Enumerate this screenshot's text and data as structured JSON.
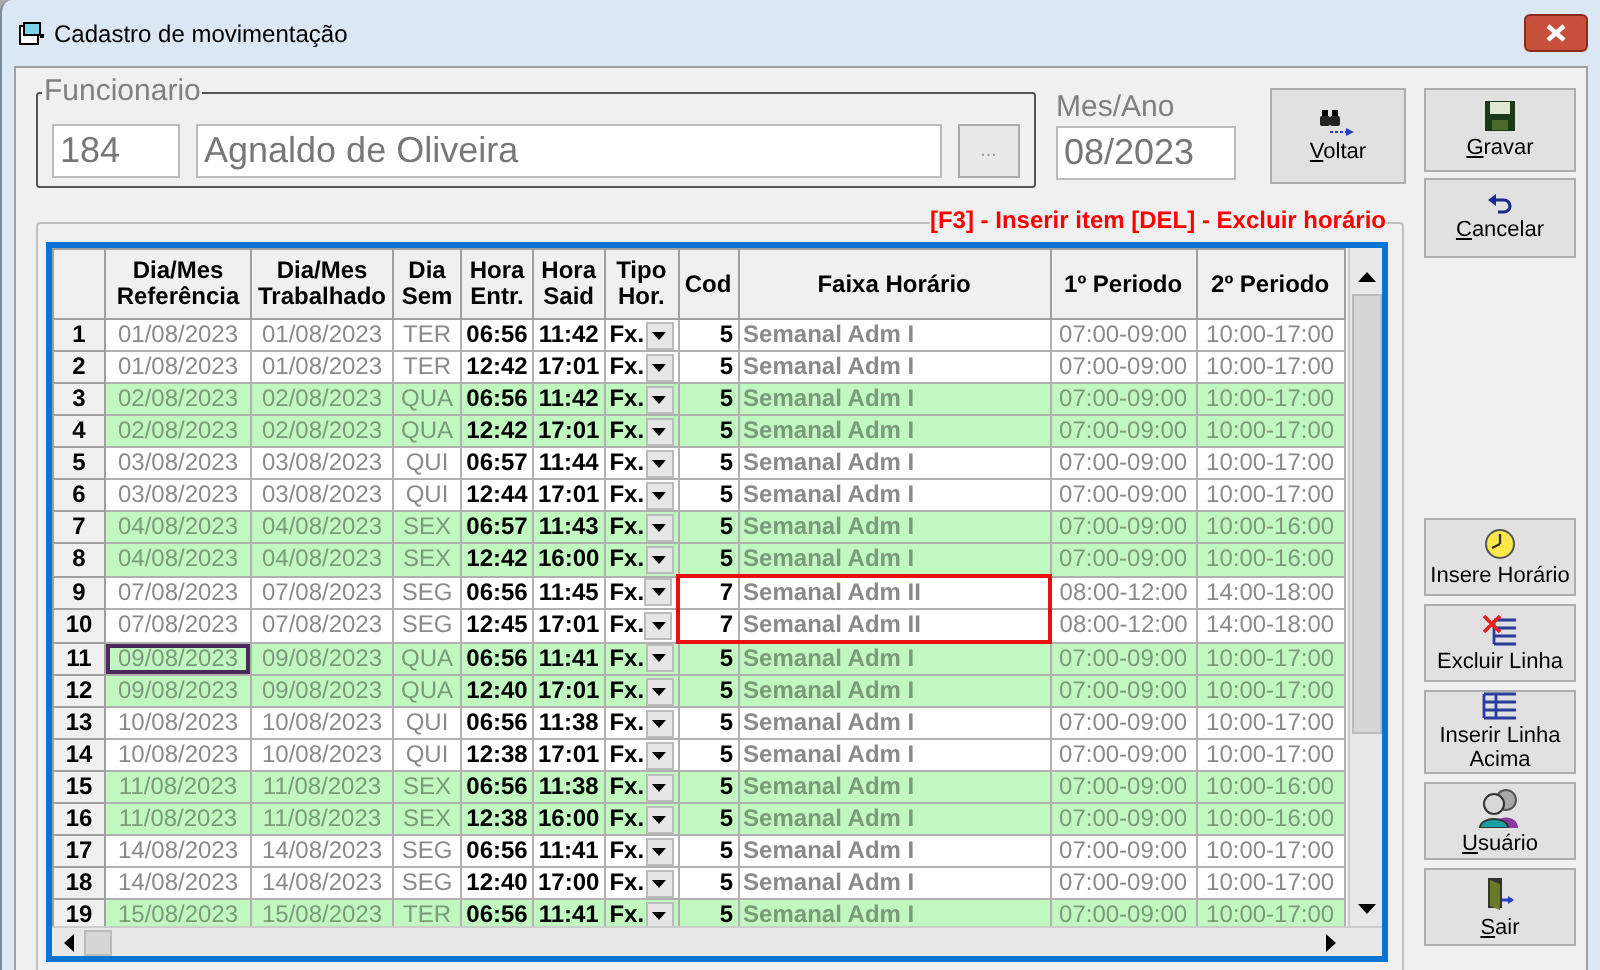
{
  "window": {
    "title": "Cadastro de movimentação"
  },
  "funcionario": {
    "label": "Funcionario",
    "code": "184",
    "name": "Agnaldo de Oliveira",
    "lookup_button": "..."
  },
  "mes_ano": {
    "label": "Mes/Ano",
    "value": "08/2023"
  },
  "top_buttons": [
    {
      "kind": "voltar",
      "label": "Voltar",
      "underline_first": true
    },
    {
      "kind": "gravar",
      "label": "Gravar",
      "underline_first": true
    },
    {
      "kind": "cancelar",
      "label": "Cancelar",
      "underline_first": true
    }
  ],
  "grid": {
    "hint": "[F3] - Inserir item [DEL] - Excluir horário",
    "columns": [
      "",
      "Dia/Mes Referência",
      "Dia/Mes Trabalhado",
      "Dia Sem",
      "Hora Entr.",
      "Hora Said",
      "Tipo Hor.",
      "Cod",
      "Faixa Horário",
      "1º Periodo",
      "2º Periodo"
    ],
    "rows": [
      {
        "n": "1",
        "ref": "01/08/2023",
        "trab": "01/08/2023",
        "dia": "TER",
        "entr": "06:56",
        "said": "11:42",
        "tipo": "Fx.",
        "cod": "5",
        "faixa": "Semanal Adm I",
        "p1": "07:00-09:00",
        "p2": "10:00-17:00",
        "shaded": false,
        "focused": false,
        "highlighted": false
      },
      {
        "n": "2",
        "ref": "01/08/2023",
        "trab": "01/08/2023",
        "dia": "TER",
        "entr": "12:42",
        "said": "17:01",
        "tipo": "Fx.",
        "cod": "5",
        "faixa": "Semanal Adm I",
        "p1": "07:00-09:00",
        "p2": "10:00-17:00",
        "shaded": false,
        "focused": false,
        "highlighted": false
      },
      {
        "n": "3",
        "ref": "02/08/2023",
        "trab": "02/08/2023",
        "dia": "QUA",
        "entr": "06:56",
        "said": "11:42",
        "tipo": "Fx.",
        "cod": "5",
        "faixa": "Semanal Adm I",
        "p1": "07:00-09:00",
        "p2": "10:00-17:00",
        "shaded": true,
        "focused": false,
        "highlighted": false
      },
      {
        "n": "4",
        "ref": "02/08/2023",
        "trab": "02/08/2023",
        "dia": "QUA",
        "entr": "12:42",
        "said": "17:01",
        "tipo": "Fx.",
        "cod": "5",
        "faixa": "Semanal Adm I",
        "p1": "07:00-09:00",
        "p2": "10:00-17:00",
        "shaded": true,
        "focused": false,
        "highlighted": false
      },
      {
        "n": "5",
        "ref": "03/08/2023",
        "trab": "03/08/2023",
        "dia": "QUI",
        "entr": "06:57",
        "said": "11:44",
        "tipo": "Fx.",
        "cod": "5",
        "faixa": "Semanal Adm I",
        "p1": "07:00-09:00",
        "p2": "10:00-17:00",
        "shaded": false,
        "focused": false,
        "highlighted": false
      },
      {
        "n": "6",
        "ref": "03/08/2023",
        "trab": "03/08/2023",
        "dia": "QUI",
        "entr": "12:44",
        "said": "17:01",
        "tipo": "Fx.",
        "cod": "5",
        "faixa": "Semanal Adm I",
        "p1": "07:00-09:00",
        "p2": "10:00-17:00",
        "shaded": false,
        "focused": false,
        "highlighted": false
      },
      {
        "n": "7",
        "ref": "04/08/2023",
        "trab": "04/08/2023",
        "dia": "SEX",
        "entr": "06:57",
        "said": "11:43",
        "tipo": "Fx.",
        "cod": "5",
        "faixa": "Semanal Adm I",
        "p1": "07:00-09:00",
        "p2": "10:00-16:00",
        "shaded": true,
        "focused": false,
        "highlighted": false
      },
      {
        "n": "8",
        "ref": "04/08/2023",
        "trab": "04/08/2023",
        "dia": "SEX",
        "entr": "12:42",
        "said": "16:00",
        "tipo": "Fx.",
        "cod": "5",
        "faixa": "Semanal Adm I",
        "p1": "07:00-09:00",
        "p2": "10:00-16:00",
        "shaded": true,
        "focused": false,
        "highlighted": false
      },
      {
        "n": "9",
        "ref": "07/08/2023",
        "trab": "07/08/2023",
        "dia": "SEG",
        "entr": "06:56",
        "said": "11:45",
        "tipo": "Fx.",
        "cod": "7",
        "faixa": "Semanal Adm II",
        "p1": "08:00-12:00",
        "p2": "14:00-18:00",
        "shaded": false,
        "focused": false,
        "highlighted": true
      },
      {
        "n": "10",
        "ref": "07/08/2023",
        "trab": "07/08/2023",
        "dia": "SEG",
        "entr": "12:45",
        "said": "17:01",
        "tipo": "Fx.",
        "cod": "7",
        "faixa": "Semanal Adm II",
        "p1": "08:00-12:00",
        "p2": "14:00-18:00",
        "shaded": false,
        "focused": false,
        "highlighted": true
      },
      {
        "n": "11",
        "ref": "09/08/2023",
        "trab": "09/08/2023",
        "dia": "QUA",
        "entr": "06:56",
        "said": "11:41",
        "tipo": "Fx.",
        "cod": "5",
        "faixa": "Semanal Adm I",
        "p1": "07:00-09:00",
        "p2": "10:00-17:00",
        "shaded": true,
        "focused": true,
        "highlighted": false
      },
      {
        "n": "12",
        "ref": "09/08/2023",
        "trab": "09/08/2023",
        "dia": "QUA",
        "entr": "12:40",
        "said": "17:01",
        "tipo": "Fx.",
        "cod": "5",
        "faixa": "Semanal Adm I",
        "p1": "07:00-09:00",
        "p2": "10:00-17:00",
        "shaded": true,
        "focused": false,
        "highlighted": false
      },
      {
        "n": "13",
        "ref": "10/08/2023",
        "trab": "10/08/2023",
        "dia": "QUI",
        "entr": "06:56",
        "said": "11:38",
        "tipo": "Fx.",
        "cod": "5",
        "faixa": "Semanal Adm I",
        "p1": "07:00-09:00",
        "p2": "10:00-17:00",
        "shaded": false,
        "focused": false,
        "highlighted": false
      },
      {
        "n": "14",
        "ref": "10/08/2023",
        "trab": "10/08/2023",
        "dia": "QUI",
        "entr": "12:38",
        "said": "17:01",
        "tipo": "Fx.",
        "cod": "5",
        "faixa": "Semanal Adm I",
        "p1": "07:00-09:00",
        "p2": "10:00-17:00",
        "shaded": false,
        "focused": false,
        "highlighted": false
      },
      {
        "n": "15",
        "ref": "11/08/2023",
        "trab": "11/08/2023",
        "dia": "SEX",
        "entr": "06:56",
        "said": "11:38",
        "tipo": "Fx.",
        "cod": "5",
        "faixa": "Semanal Adm I",
        "p1": "07:00-09:00",
        "p2": "10:00-16:00",
        "shaded": true,
        "focused": false,
        "highlighted": false
      },
      {
        "n": "16",
        "ref": "11/08/2023",
        "trab": "11/08/2023",
        "dia": "SEX",
        "entr": "12:38",
        "said": "16:00",
        "tipo": "Fx.",
        "cod": "5",
        "faixa": "Semanal Adm I",
        "p1": "07:00-09:00",
        "p2": "10:00-16:00",
        "shaded": true,
        "focused": false,
        "highlighted": false
      },
      {
        "n": "17",
        "ref": "14/08/2023",
        "trab": "14/08/2023",
        "dia": "SEG",
        "entr": "06:56",
        "said": "11:41",
        "tipo": "Fx.",
        "cod": "5",
        "faixa": "Semanal Adm I",
        "p1": "07:00-09:00",
        "p2": "10:00-17:00",
        "shaded": false,
        "focused": false,
        "highlighted": false
      },
      {
        "n": "18",
        "ref": "14/08/2023",
        "trab": "14/08/2023",
        "dia": "SEG",
        "entr": "12:40",
        "said": "17:00",
        "tipo": "Fx.",
        "cod": "5",
        "faixa": "Semanal Adm I",
        "p1": "07:00-09:00",
        "p2": "10:00-17:00",
        "shaded": false,
        "focused": false,
        "highlighted": false
      },
      {
        "n": "19",
        "ref": "15/08/2023",
        "trab": "15/08/2023",
        "dia": "TER",
        "entr": "06:56",
        "said": "11:41",
        "tipo": "Fx.",
        "cod": "5",
        "faixa": "Semanal Adm I",
        "p1": "07:00-09:00",
        "p2": "10:00-17:00",
        "shaded": true,
        "focused": false,
        "highlighted": false
      }
    ]
  },
  "side_buttons": [
    {
      "kind": "clock",
      "label": "Insere Horário",
      "underline_first": false
    },
    {
      "kind": "delete-row",
      "label": "Excluir Linha",
      "underline_first": false
    },
    {
      "kind": "insert-row",
      "label": "Inserir Linha Acima",
      "underline_first": false
    },
    {
      "kind": "users",
      "label": "Usuário",
      "underline_first": true
    },
    {
      "kind": "exit",
      "label": "Sair",
      "underline_first": true
    }
  ]
}
